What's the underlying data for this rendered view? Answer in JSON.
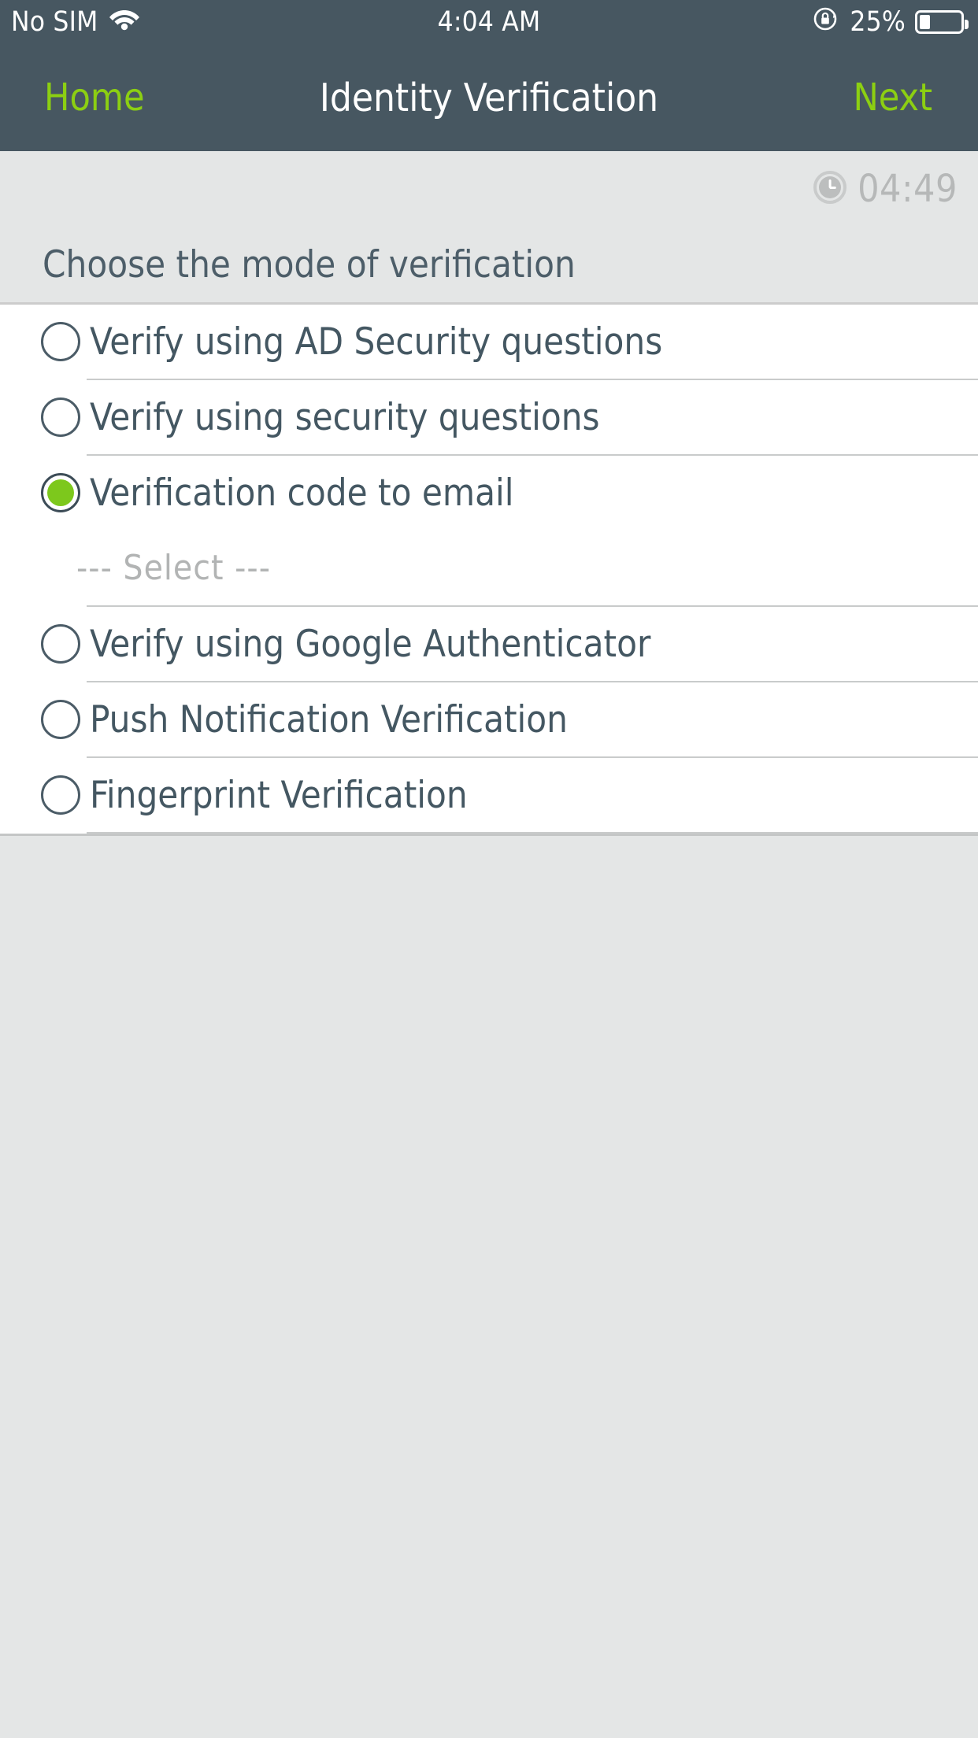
{
  "status_bar": {
    "carrier": "No SIM",
    "wifi_icon": "wifi-icon",
    "time": "4:04 AM",
    "rotation_lock_icon": "rotation-lock-icon",
    "battery_percent": "25%",
    "battery_level": 25
  },
  "nav_bar": {
    "back_label": "Home",
    "title": "Identity Verification",
    "next_label": "Next",
    "background": "#475761",
    "accent": "#8ccf12"
  },
  "timer": {
    "icon": "clock-icon",
    "value": "04:49"
  },
  "section": {
    "heading": "Choose the mode of verification"
  },
  "options": [
    {
      "label": "Verify using AD Security questions",
      "selected": false
    },
    {
      "label": "Verify using security questions",
      "selected": false
    },
    {
      "label": "Verification code to email",
      "selected": true
    },
    {
      "label": "Verify using Google Authenticator",
      "selected": false
    },
    {
      "label": "Push Notification Verification",
      "selected": false
    },
    {
      "label": "Fingerprint Verification",
      "selected": false
    }
  ],
  "email_select": {
    "placeholder": "--- Select ---",
    "value": "--- Select ---"
  },
  "colors": {
    "header_bg": "#475761",
    "accent_green": "#8ccf12",
    "radio_green": "#7dc81c",
    "page_bg": "#e4e6e6",
    "list_bg": "#ffffff",
    "text_primary": "#445762",
    "text_muted": "#b2b4b4"
  }
}
